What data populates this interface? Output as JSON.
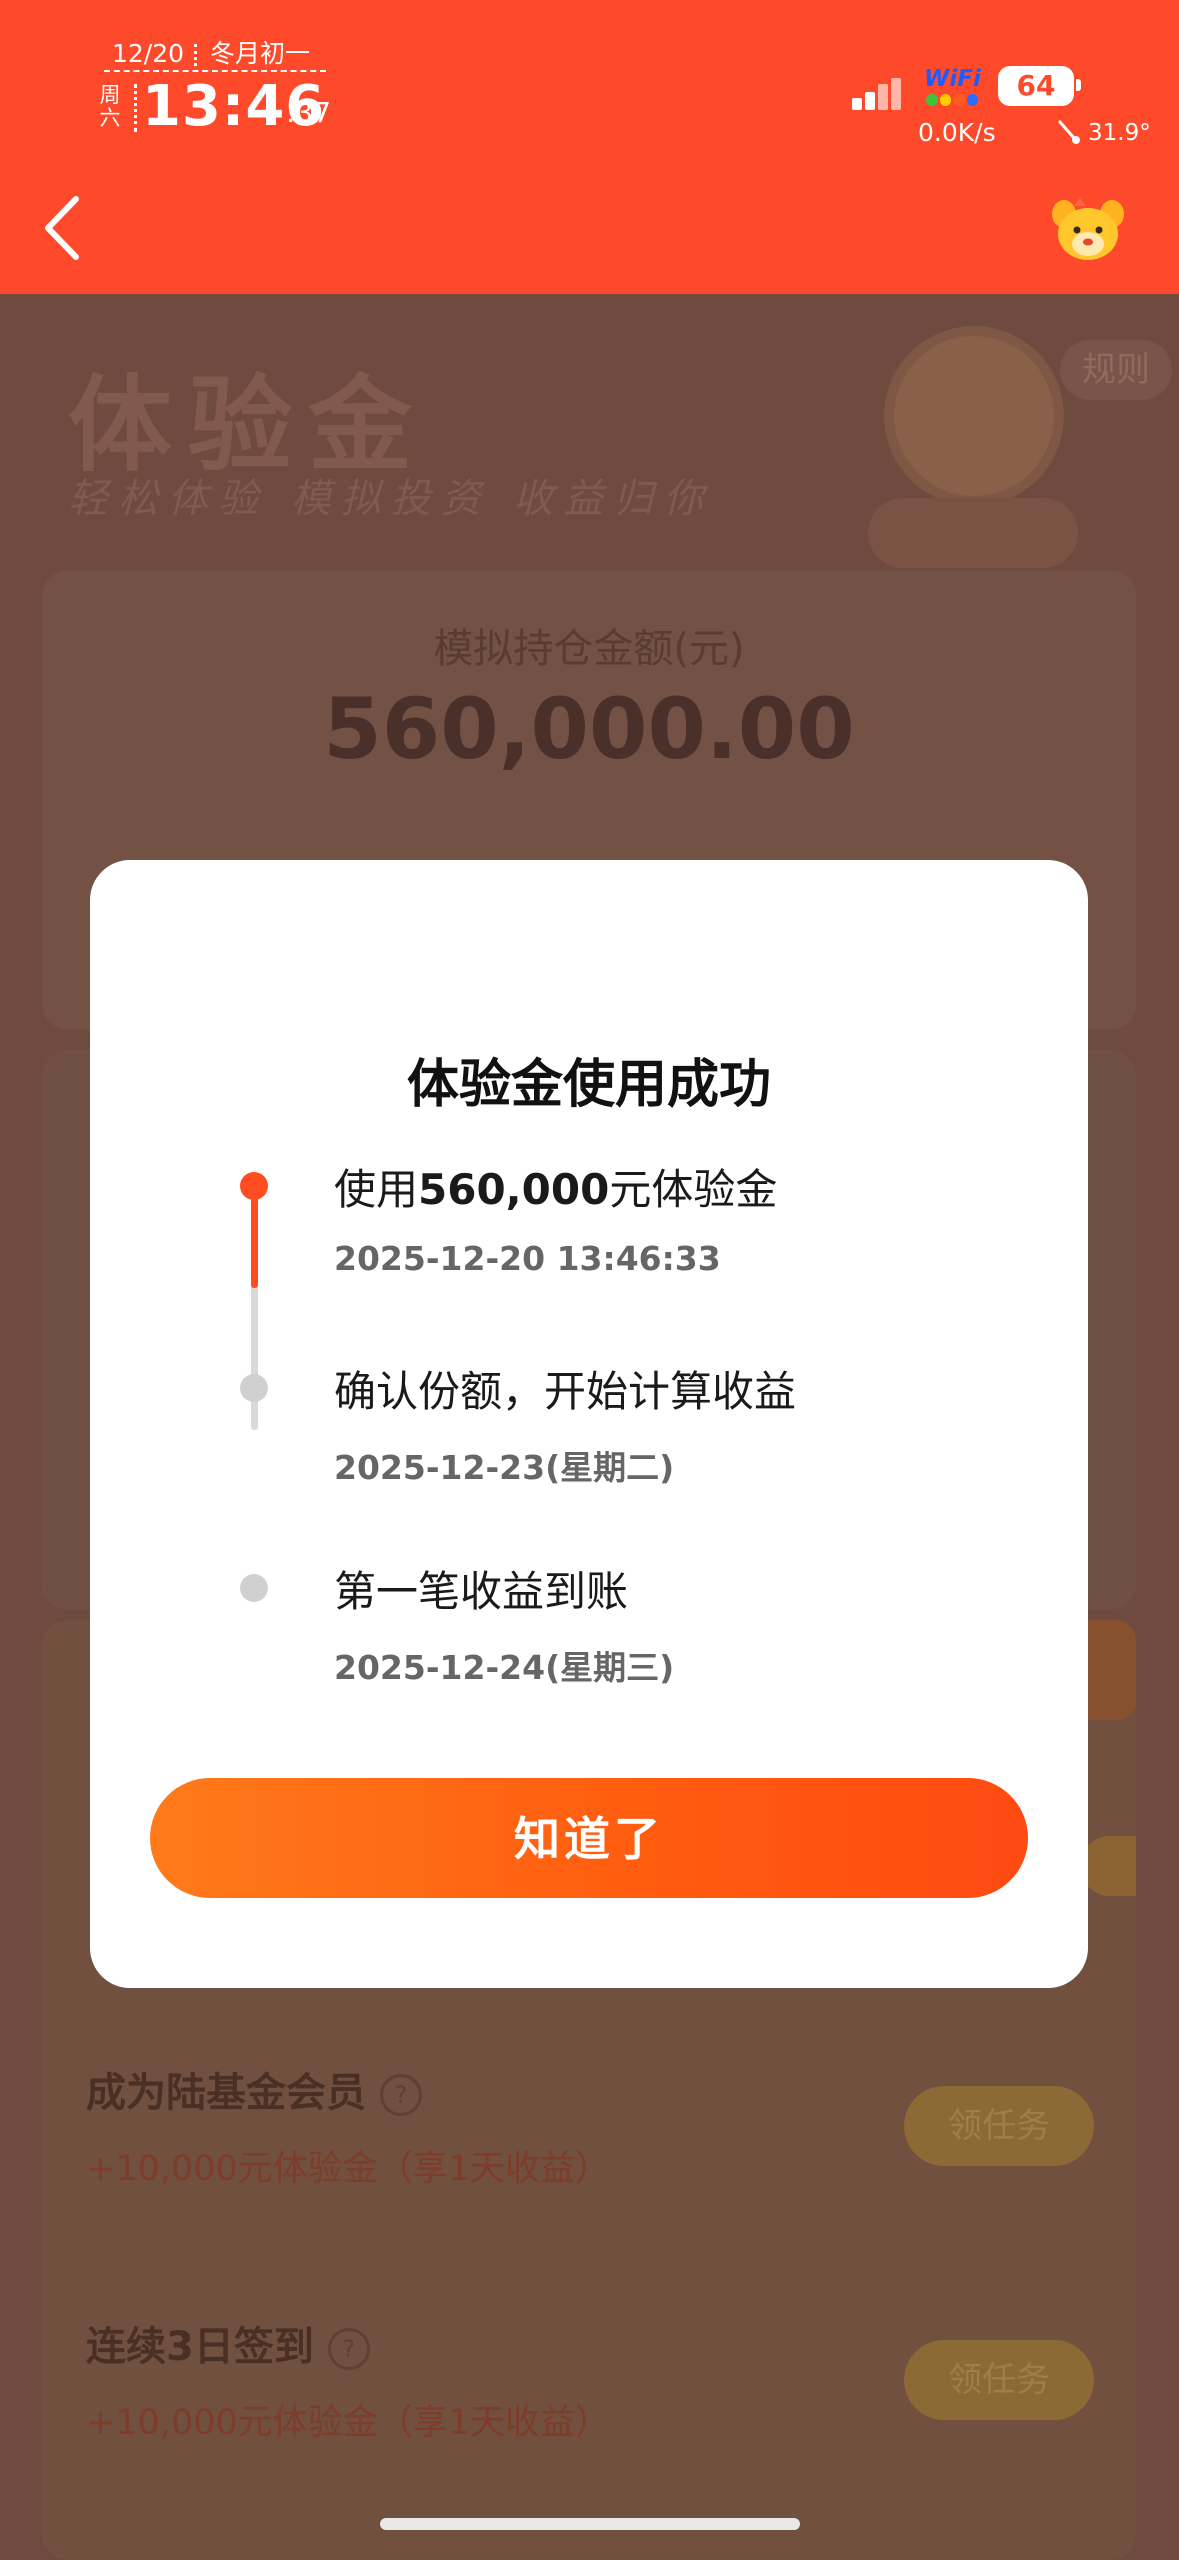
{
  "status_bar": {
    "date": "12/20",
    "lunar": "冬月初一",
    "weekday": "周六",
    "time": "13:46",
    "seconds": ":37",
    "wifi_label": "WiFi",
    "battery": "64",
    "net_speed": "0.0K/s",
    "temperature": "31.9°"
  },
  "header": {
    "back_icon": "chevron-left-icon",
    "mascot_icon": "mascot-icon"
  },
  "hero": {
    "title": "体验金",
    "subtitle": "轻松体验 模拟投资 收益归你",
    "rules_label": "规则"
  },
  "holding_card": {
    "label": "模拟持仓金额(元)",
    "amount": "560,000.00"
  },
  "tasks": [
    {
      "title": "成为陆基金会员",
      "reward": "+10,000元体验金（享1天收益）",
      "button": "领任务"
    },
    {
      "title": "连续3日签到",
      "reward": "+10,000元体验金（享1天收益）",
      "button": "领任务"
    }
  ],
  "modal": {
    "title": "体验金使用成功",
    "steps": [
      {
        "title_pre": "使用",
        "title_bold": "560,000",
        "title_post": "元体验金",
        "date": "2025-12-20 13:46:33",
        "active": true
      },
      {
        "title": "确认份额，开始计算收益",
        "date": "2025-12-23(星期二)",
        "active": false
      },
      {
        "title": "第一笔收益到账",
        "date": "2025-12-24(星期三)",
        "active": false
      }
    ],
    "confirm_button": "知道了"
  },
  "colors": {
    "brand": "#fe4a2b",
    "button_start": "#ff7a1a",
    "button_end": "#ff4a12",
    "timeline_active": "#ff4d21",
    "timeline_inactive": "#d0d0d0"
  }
}
